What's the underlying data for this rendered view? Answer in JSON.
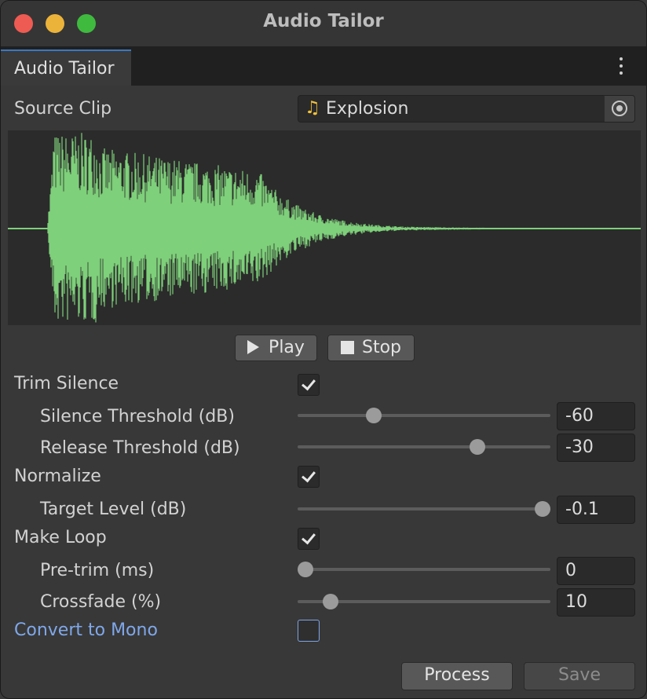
{
  "window": {
    "title": "Audio Tailor"
  },
  "tab": {
    "label": "Audio Tailor"
  },
  "source_clip": {
    "label": "Source Clip",
    "value": "Explosion"
  },
  "colors": {
    "waveform": "#7ed07a",
    "accent": "#3a78c2",
    "link": "#7fa8ea"
  },
  "playback": {
    "play_label": "Play",
    "stop_label": "Stop"
  },
  "trim_silence": {
    "label": "Trim Silence",
    "checked": true,
    "silence_threshold": {
      "label": "Silence Threshold (dB)",
      "value": "-60",
      "level": 0.3
    },
    "release_threshold": {
      "label": "Release Threshold (dB)",
      "value": "-30",
      "level": 0.71
    }
  },
  "normalize": {
    "label": "Normalize",
    "checked": true,
    "target_level": {
      "label": "Target Level (dB)",
      "value": "-0.1",
      "level": 0.97
    }
  },
  "make_loop": {
    "label": "Make Loop",
    "checked": true,
    "pre_trim": {
      "label": "Pre-trim (ms)",
      "value": "0",
      "level": 0.03
    },
    "crossfade": {
      "label": "Crossfade (%)",
      "value": "10",
      "level": 0.13
    }
  },
  "convert_to_mono": {
    "label": "Convert to Mono",
    "checked": false
  },
  "actions": {
    "process_label": "Process",
    "save_label": "Save"
  }
}
